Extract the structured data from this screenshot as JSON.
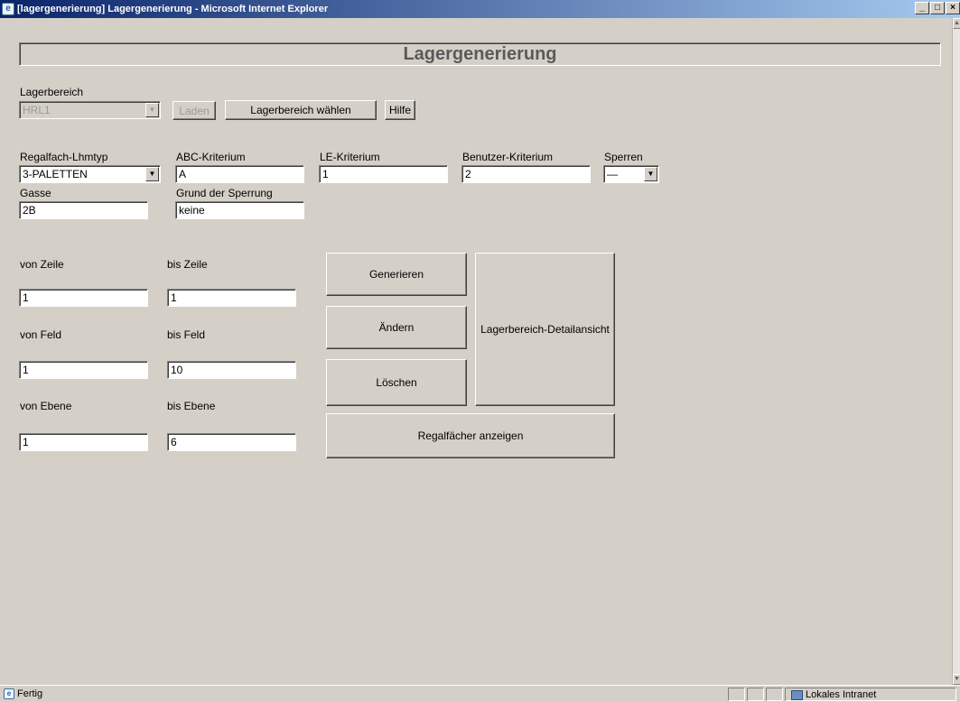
{
  "window": {
    "title": "[lagergenerierung] Lagergenerierung - Microsoft Internet Explorer",
    "min": "_",
    "max": "□",
    "close": "×"
  },
  "page": {
    "heading": "Lagergenerierung"
  },
  "lagerbereich": {
    "label": "Lagerbereich",
    "value": "HRL1",
    "laden": "Laden",
    "waehlen": "Lagerbereich wählen",
    "hilfe": "Hilfe"
  },
  "filters": {
    "regalfach_label": "Regalfach-Lhmtyp",
    "regalfach_value": "3-PALETTEN",
    "abc_label": "ABC-Kriterium",
    "abc_value": "A",
    "le_label": "LE-Kriterium",
    "le_value": "1",
    "benutzer_label": "Benutzer-Kriterium",
    "benutzer_value": "2",
    "sperren_label": "Sperren",
    "sperren_value": "—",
    "gasse_label": "Gasse",
    "gasse_value": "2B",
    "grund_label": "Grund der Sperrung",
    "grund_value": "keine"
  },
  "ranges": {
    "von_zeile_label": "von Zeile",
    "bis_zeile_label": "bis Zeile",
    "von_zeile": "1",
    "bis_zeile": "1",
    "von_feld_label": "von Feld",
    "bis_feld_label": "bis Feld",
    "von_feld": "1",
    "bis_feld": "10",
    "von_ebene_label": "von Ebene",
    "bis_ebene_label": "bis Ebene",
    "von_ebene": "1",
    "bis_ebene": "6"
  },
  "actions": {
    "generieren": "Generieren",
    "aendern": "Ändern",
    "loeschen": "Löschen",
    "detailansicht": "Lagerbereich-Detailansicht",
    "regalfaecher": "Regalfächer anzeigen"
  },
  "status": {
    "text": "Fertig",
    "zone": "Lokales Intranet"
  },
  "colors": {
    "face": "#d4d0c8",
    "title_start": "#0a246a",
    "title_end": "#a6caf0"
  }
}
